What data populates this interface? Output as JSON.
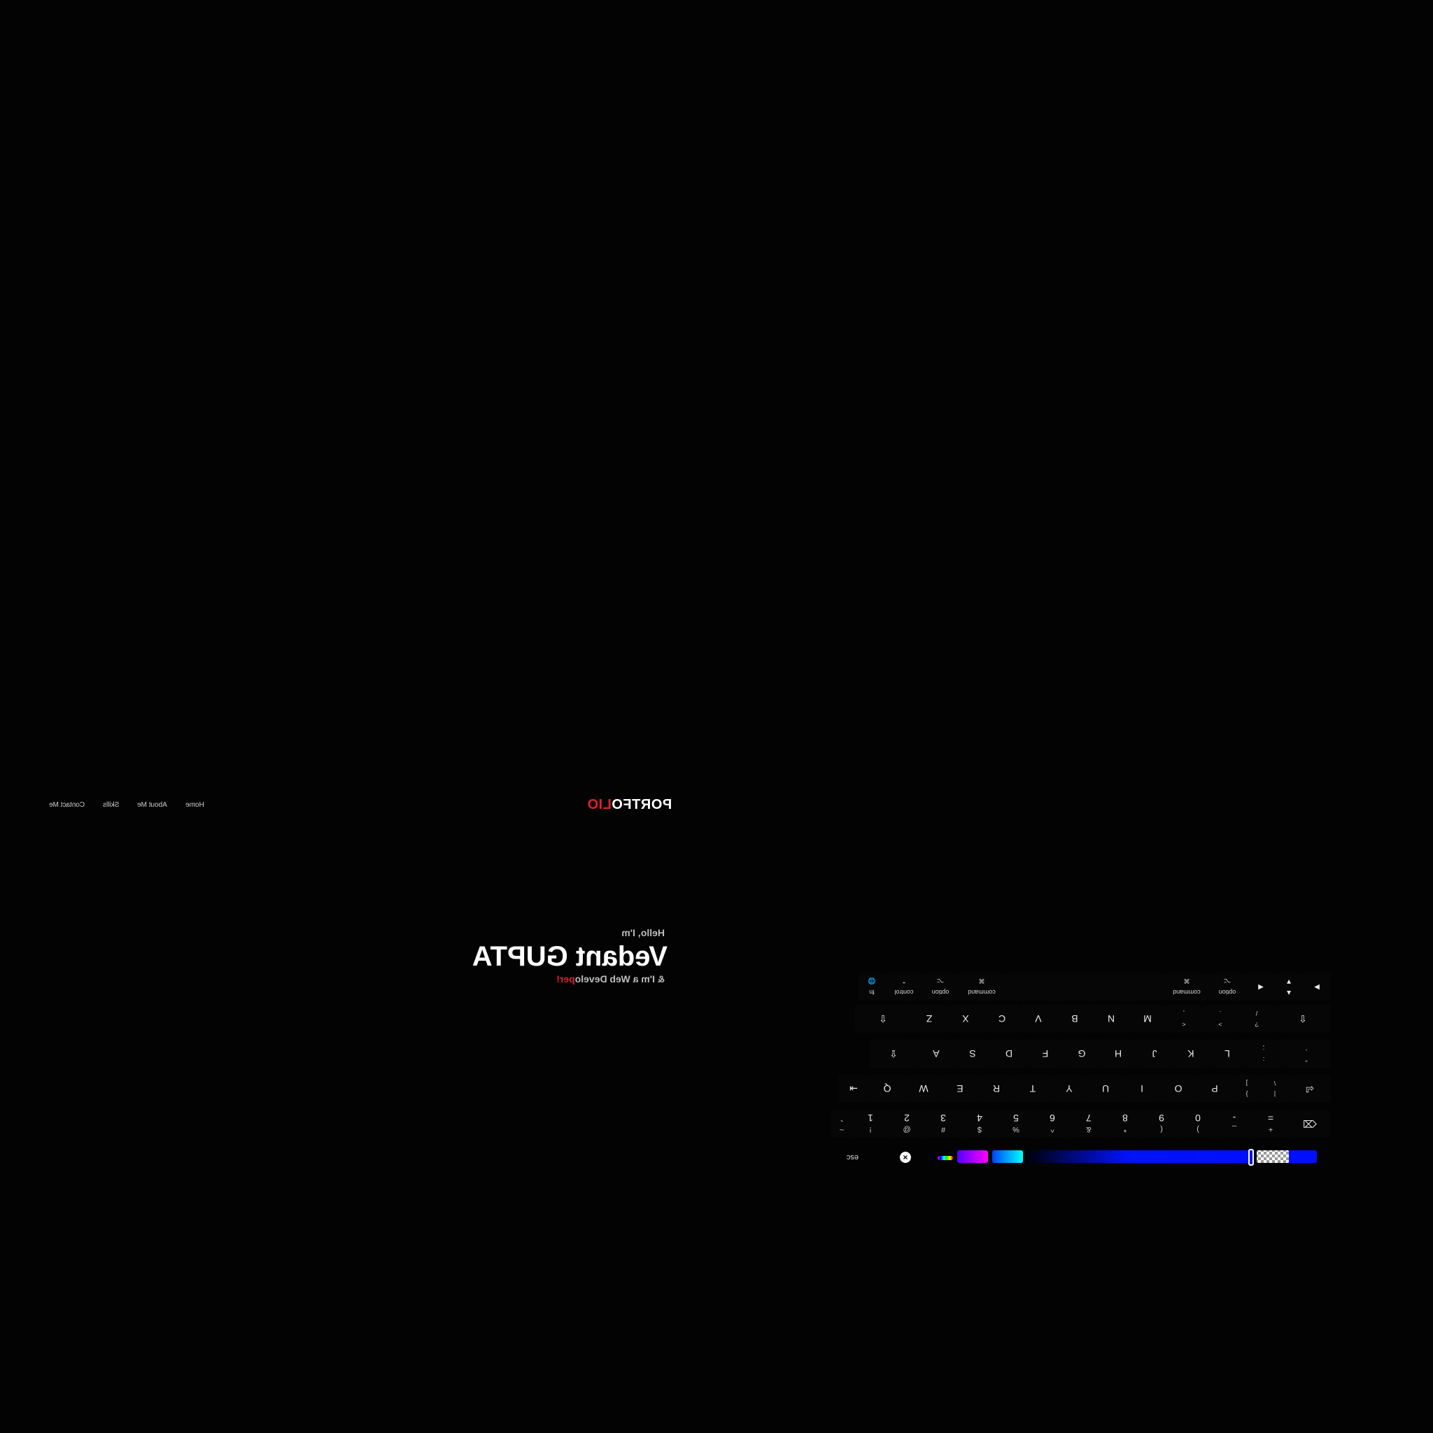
{
  "portfolio": {
    "brand": {
      "main": "PORTFO",
      "accent": "LIO"
    },
    "nav": [
      "Home",
      "About Me",
      "Skills",
      "Contact Me"
    ],
    "hero": {
      "hello": "Hello, I'm",
      "name": "Vedant GUPTA",
      "role_prefix": "& I'm a Web Develo",
      "role_accent": "per!"
    },
    "colors": {
      "accent": "#e11d2e",
      "background": "#030303"
    }
  },
  "keyboard": {
    "row_numbers": [
      {
        "top": "~",
        "main": "`"
      },
      {
        "top": "!",
        "main": "1"
      },
      {
        "top": "@",
        "main": "2"
      },
      {
        "top": "#",
        "main": "3"
      },
      {
        "top": "$",
        "main": "4"
      },
      {
        "top": "%",
        "main": "5"
      },
      {
        "top": "^",
        "main": "6"
      },
      {
        "top": "&",
        "main": "7"
      },
      {
        "top": "*",
        "main": "8"
      },
      {
        "top": "(",
        "main": "9"
      },
      {
        "top": ")",
        "main": "0"
      },
      {
        "top": "_",
        "main": "-"
      },
      {
        "top": "+",
        "main": "="
      }
    ],
    "row_qwerty": [
      "Q",
      "W",
      "E",
      "R",
      "T",
      "Y",
      "U",
      "I",
      "O",
      "P"
    ],
    "row_qwerty_extra": [
      {
        "top": "{",
        "main": "["
      },
      {
        "top": "}",
        "main": "]"
      },
      {
        "top": "|",
        "main": "\\"
      }
    ],
    "row_home": [
      "A",
      "S",
      "D",
      "F",
      "G",
      "H",
      "J",
      "K",
      "L"
    ],
    "row_home_extra": [
      {
        "top": ":",
        "main": ";"
      },
      {
        "top": "\"",
        "main": "'"
      }
    ],
    "row_bottom": [
      "Z",
      "X",
      "C",
      "V",
      "B",
      "N",
      "M"
    ],
    "row_bottom_extra": [
      {
        "top": "<",
        "main": ","
      },
      {
        "top": ">",
        "main": "."
      },
      {
        "top": "?",
        "main": "/"
      }
    ],
    "modifiers": {
      "fn": "fn",
      "control": "control",
      "option": "option",
      "command": "command",
      "esc": "esc"
    },
    "icons": [
      "globe-icon",
      "shift-icon",
      "caps-lock-icon",
      "tab-icon",
      "delete-icon",
      "return-icon",
      "arrow-up-icon",
      "arrow-down-icon",
      "arrow-left-icon",
      "arrow-right-icon"
    ],
    "palette": {
      "swatches": [
        "#00ffff",
        "#ff00ff",
        "#0010ff"
      ],
      "bar_color": "#0012f5"
    }
  }
}
